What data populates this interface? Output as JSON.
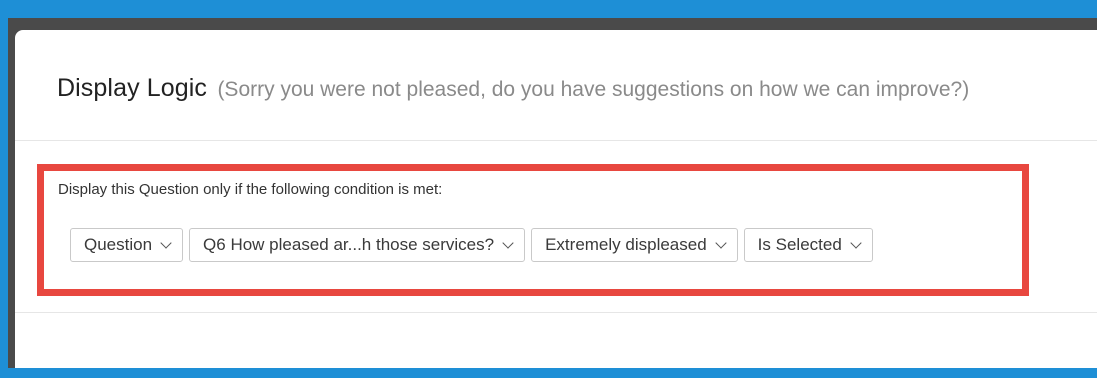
{
  "header": {
    "title": "Display Logic",
    "subtitle": "(Sorry you were not pleased, do you have suggestions on how we can improve?)"
  },
  "condition": {
    "text": "Display this Question only if the following condition is met:",
    "dropdowns": [
      {
        "label": "Question",
        "icon": "chevron-down-icon"
      },
      {
        "label": "Q6 How pleased ar...h those services?",
        "icon": "chevron-down-icon"
      },
      {
        "label": "Extremely displeased",
        "icon": "chevron-down-icon"
      },
      {
        "label": "Is Selected",
        "icon": "chevron-down-icon"
      }
    ]
  },
  "colors": {
    "outer_background": "#1e8fd6",
    "highlight_border": "#e8473f",
    "panel": "#ffffff"
  }
}
